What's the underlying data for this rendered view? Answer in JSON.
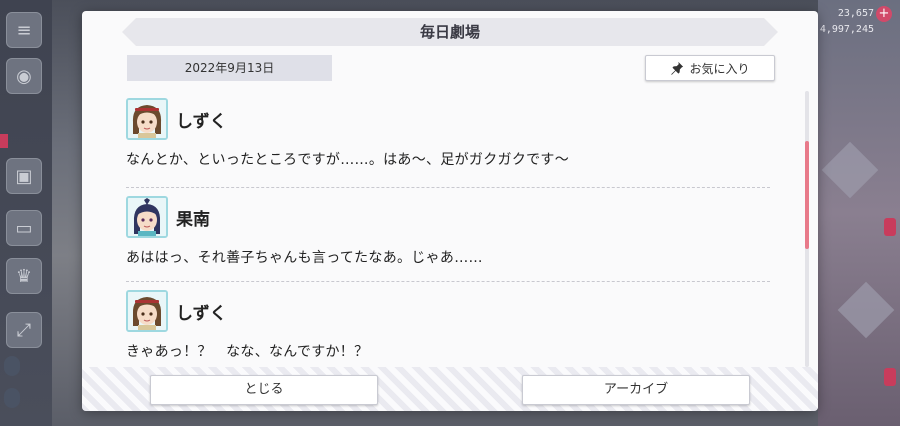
{
  "dialog": {
    "title": "毎日劇場",
    "date": "2022年9月13日",
    "favorite_label": "お気に入り"
  },
  "entries": [
    {
      "speaker": "しずく",
      "line": "なんとか、といったところですが……。はあ〜、足がガクガクです〜"
    },
    {
      "speaker": "果南",
      "line": "あははっ、それ善子ちゃんも言ってたなあ。じゃあ……"
    },
    {
      "speaker": "しずく",
      "line": "きゃあっ！？　なな、なんですか！？"
    }
  ],
  "footer": {
    "close_label": "とじる",
    "archive_label": "アーカイブ"
  },
  "scrollbar": {
    "position_fraction": 0.22,
    "visible_fraction": 0.39
  },
  "background": {
    "counter_top": "23,657",
    "counter_bottom": "4,997,245"
  },
  "colors": {
    "accent_pink": "#e87a8a",
    "avatar_border": "#9ed8e0",
    "title_bar": "#e7e7ec"
  }
}
